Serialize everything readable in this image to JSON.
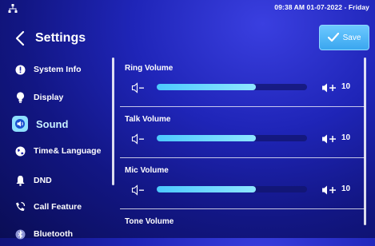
{
  "status": {
    "datetime": "09:38 AM  01-07-2022 - Friday"
  },
  "header": {
    "title": "Settings",
    "save_label": "Save"
  },
  "sidebar": {
    "items": [
      {
        "label": "System Info",
        "icon": "info-icon",
        "active": false
      },
      {
        "label": "Display",
        "icon": "bulb-icon",
        "active": false
      },
      {
        "label": "Sound",
        "icon": "speaker-icon",
        "active": true
      },
      {
        "label": "Time& Language",
        "icon": "globe-icon",
        "active": false
      },
      {
        "label": "DND",
        "icon": "bell-icon",
        "active": false
      },
      {
        "label": "Call Feature",
        "icon": "phone-icon",
        "active": false
      },
      {
        "label": "Bluetooth",
        "icon": "bluetooth-icon",
        "active": false
      }
    ]
  },
  "volumes": [
    {
      "title": "Ring Volume",
      "value": "10",
      "level": 0.66
    },
    {
      "title": "Talk Volume",
      "value": "10",
      "level": 0.66
    },
    {
      "title": "Mic Volume",
      "value": "10",
      "level": 0.66
    },
    {
      "title": "Tone Volume"
    }
  ],
  "colors": {
    "accent": "#4cc9ff",
    "save_button": "#4fb6f5",
    "background": "#1a1fa8"
  }
}
